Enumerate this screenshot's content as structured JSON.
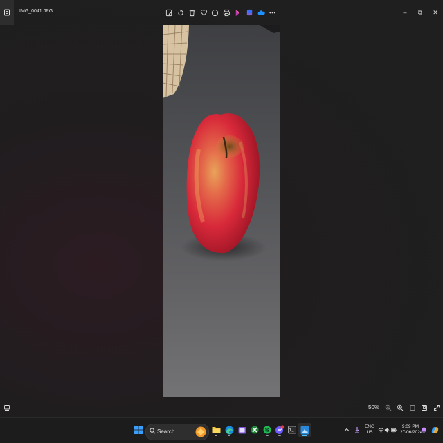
{
  "window": {
    "file_name": "IMG_0041.JPG",
    "toolbar_icons": [
      "edit-icon",
      "rotate-icon",
      "delete-icon",
      "favorite-icon",
      "info-icon",
      "print-icon",
      "clipchamp-icon",
      "designer-icon",
      "onedrive-icon",
      "more-icon"
    ],
    "controls": {
      "minimize": "–",
      "maximize": "⧉",
      "close": "✕"
    }
  },
  "photo": {
    "subject": "apple"
  },
  "statusbar": {
    "zoom": "50%"
  },
  "taskbar": {
    "search_label": "Search",
    "language": {
      "line1": "ENG",
      "line2": "US"
    },
    "clock": {
      "time": "9:09 PM",
      "date": "27/06/2024"
    },
    "colors": {
      "accent": "#4cc2ff",
      "start": "#3aa0ff",
      "spotify": "#1db954"
    }
  }
}
